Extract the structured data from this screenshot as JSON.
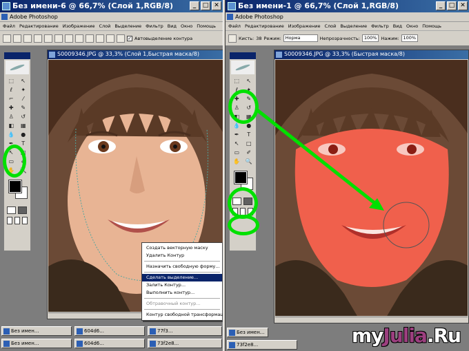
{
  "left_window": {
    "title": "Без имени-6 @ 66,7% (Слой 1,RGB/8)",
    "app_title": "Adobe Photoshop",
    "menu": [
      "Файл",
      "Редактирование",
      "Изображение",
      "Слой",
      "Выделение",
      "Фильтр",
      "Вид",
      "Окно",
      "Помощь"
    ],
    "options_checkbox_label": "Автовыделение контура",
    "document": {
      "title": "S0009346.JPG @ 33,3% (Слой 1,Быстрая маска/8)"
    },
    "context_menu": [
      {
        "label": "Создать векторную маску",
        "state": "normal"
      },
      {
        "label": "Удалить Контур",
        "state": "normal"
      },
      {
        "label": "separator"
      },
      {
        "label": "Назначить свободную форму...",
        "state": "normal"
      },
      {
        "label": "separator"
      },
      {
        "label": "Сделать выделение...",
        "state": "active"
      },
      {
        "label": "Залить Контур...",
        "state": "normal"
      },
      {
        "label": "Выполнить контур...",
        "state": "normal"
      },
      {
        "label": "separator"
      },
      {
        "label": "Обтравочный контур...",
        "state": "disabled"
      },
      {
        "label": "separator"
      },
      {
        "label": "Контур свободной трансформации",
        "state": "normal"
      }
    ]
  },
  "right_window": {
    "title": "Без имени-1 @ 66,7% (Слой 1,RGB/8)",
    "app_title": "Adobe Photoshop",
    "menu": [
      "Файл",
      "Редактирование",
      "Изображение",
      "Слой",
      "Выделение",
      "Фильтр",
      "Вид",
      "Окно",
      "Помощь"
    ],
    "options": {
      "brush_label": "Кисть:",
      "brush_size": "38",
      "mode_label": "Режим:",
      "mode_value": "Норма",
      "opacity_label": "Непрозрачность:",
      "opacity_value": "100%",
      "flow_label": "Нажим:",
      "flow_value": "100%"
    },
    "document": {
      "title": "S0009346.JPG @ 33,3% (Быстрая маска/8)"
    }
  },
  "taskbar_left": [
    "Без имен...",
    "604d6...",
    "77f3..."
  ],
  "taskbar_left_row2": [
    "Без имен...",
    "604d6...",
    "73f2e8..."
  ],
  "taskbar_right_row1": [
    "Без имен..."
  ],
  "taskbar_right_row2": [
    "73f2e8..."
  ],
  "watermark": {
    "text_pre": "my",
    "text_accent": "Julia",
    "text_post": ".Ru"
  },
  "colors": {
    "highlight": "#00e000",
    "mask": "#f0604c",
    "title_bar": "#0a246a"
  }
}
